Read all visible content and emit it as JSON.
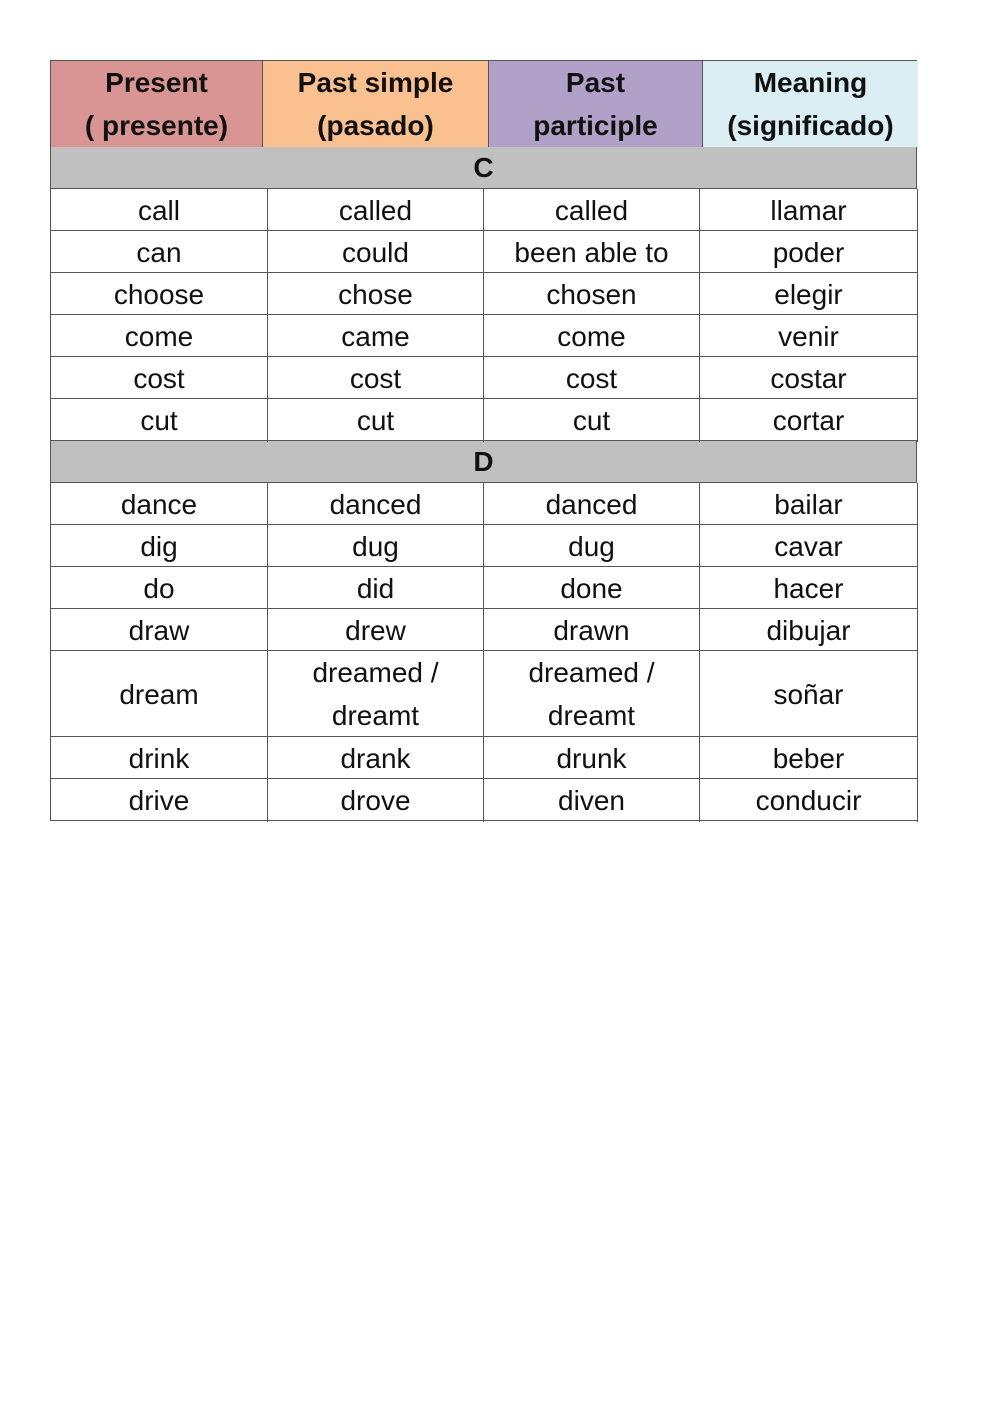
{
  "header": {
    "columns": [
      {
        "label": "Present\n( presente)",
        "color": "#d99594"
      },
      {
        "label": "Past simple\n(pasado)",
        "color": "#fac090"
      },
      {
        "label": "Past\nparticiple",
        "color": "#b1a0c7"
      },
      {
        "label": "Meaning\n(significado)",
        "color": "#daeef3"
      }
    ]
  },
  "sections": [
    {
      "letter": "C",
      "rows": [
        [
          "call",
          "called",
          "called",
          "llamar"
        ],
        [
          "can",
          "could",
          "been able  to",
          "poder"
        ],
        [
          "choose",
          "chose",
          "chosen",
          "elegir"
        ],
        [
          "come",
          "came",
          "come",
          "venir"
        ],
        [
          "cost",
          "cost",
          "cost",
          "costar"
        ],
        [
          "cut",
          "cut",
          "cut",
          "cortar"
        ]
      ]
    },
    {
      "letter": "D",
      "rows": [
        [
          "dance",
          "danced",
          "danced",
          "bailar"
        ],
        [
          "dig",
          "dug",
          "dug",
          "cavar"
        ],
        [
          "do",
          "did",
          "done",
          "hacer"
        ],
        [
          "draw",
          "drew",
          "drawn",
          "dibujar"
        ],
        [
          "dream",
          "dreamed  /\ndreamt",
          "dreamed  /\ndreamt",
          "soñar"
        ],
        [
          "drink",
          "drank",
          "drunk",
          "beber"
        ],
        [
          "drive",
          "drove",
          "diven",
          "conducir"
        ]
      ]
    }
  ],
  "section_color": "#c0c0c0"
}
